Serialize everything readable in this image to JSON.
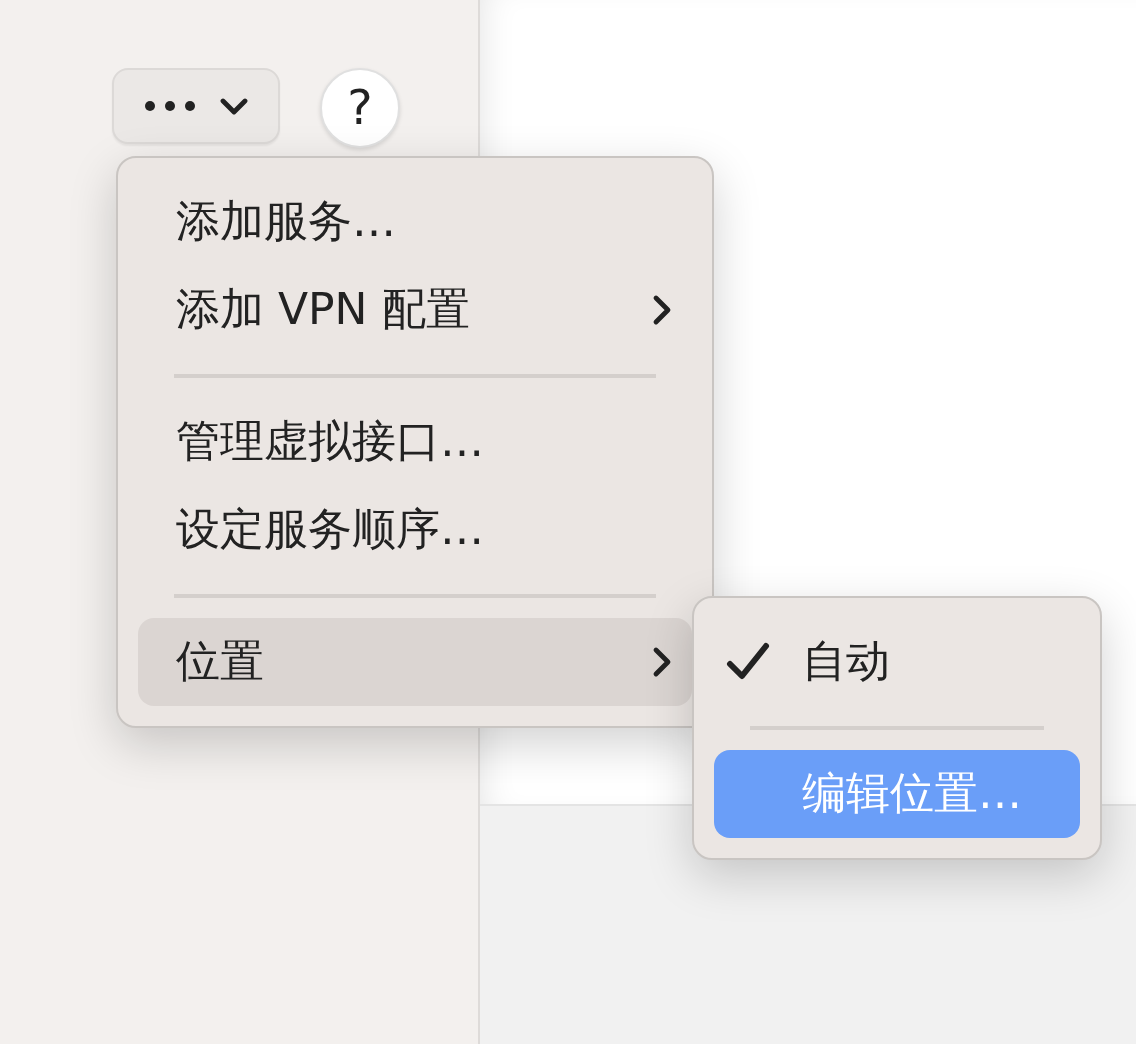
{
  "toolbar": {
    "help_label": "?"
  },
  "menu": {
    "items": [
      {
        "kind": "item",
        "label": "添加服务…",
        "has_submenu": false,
        "selected": false
      },
      {
        "kind": "item",
        "label": "添加 VPN 配置",
        "has_submenu": true,
        "selected": false
      },
      {
        "kind": "separator"
      },
      {
        "kind": "item",
        "label": "管理虚拟接口…",
        "has_submenu": false,
        "selected": false
      },
      {
        "kind": "item",
        "label": "设定服务顺序…",
        "has_submenu": false,
        "selected": false
      },
      {
        "kind": "separator"
      },
      {
        "kind": "item",
        "label": "位置",
        "has_submenu": true,
        "selected": true
      }
    ]
  },
  "submenu": {
    "items": [
      {
        "kind": "item",
        "label": "自动",
        "checked": true,
        "selected": false
      },
      {
        "kind": "separator"
      },
      {
        "kind": "item",
        "label": "编辑位置…",
        "checked": false,
        "selected": true
      }
    ]
  }
}
